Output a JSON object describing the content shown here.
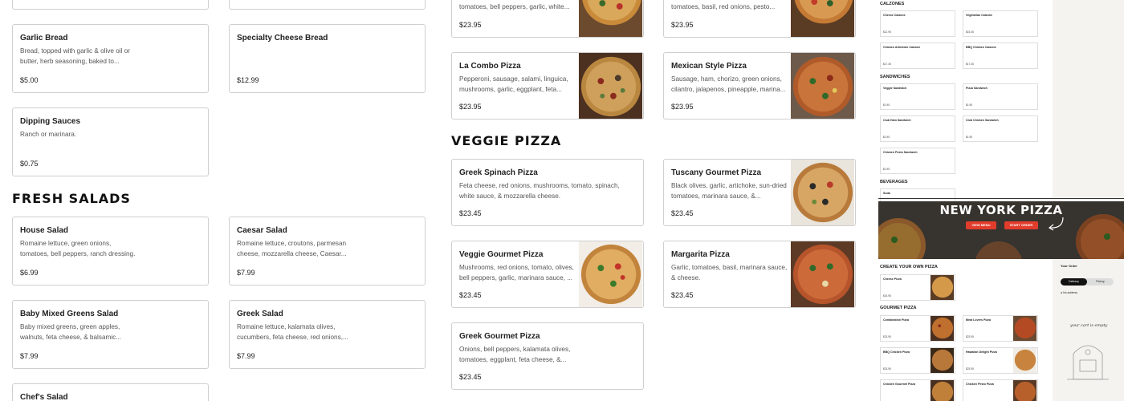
{
  "col1": {
    "sides": [
      {
        "name": "Garlic Bread",
        "desc": "Bread, topped with garlic & olive oil or butter, herb seasoning, baked to...",
        "price": "$5.00"
      },
      {
        "name": "Specialty Cheese Bread",
        "desc": "",
        "price": "$12.99"
      },
      {
        "name": "Dipping Sauces",
        "desc": "Ranch or marinara.",
        "price": "$0.75"
      }
    ],
    "salads_title": "FRESH SALADS",
    "salads": [
      {
        "name": "House Salad",
        "desc": "Romaine lettuce, green onions, tomatoes, bell peppers, ranch dressing.",
        "price": "$6.99"
      },
      {
        "name": "Caesar Salad",
        "desc": "Romaine lettuce, croutons, parmesan cheese, mozzarella cheese, Caesar...",
        "price": "$7.99"
      },
      {
        "name": "Baby Mixed Greens Salad",
        "desc": "Baby mixed greens, green apples, walnuts, feta cheese, & balsamic...",
        "price": "$7.99"
      },
      {
        "name": "Greek Salad",
        "desc": "Romaine lettuce, kalamata olives, cucumbers, feta cheese, red onions,...",
        "price": "$7.99"
      },
      {
        "name": "Chef's Salad",
        "desc": "",
        "price": ""
      }
    ]
  },
  "col2": {
    "top": [
      {
        "name": "",
        "desc": "tomatoes, bell peppers, garlic, white...",
        "price": "$23.95"
      },
      {
        "name": "",
        "desc": "tomatoes, basil, red onions, pesto...",
        "price": "$23.95"
      },
      {
        "name": "La Combo Pizza",
        "desc": "Pepperoni, sausage, salami, linguica, mushrooms, garlic, eggplant, feta...",
        "price": "$23.95"
      },
      {
        "name": "Mexican Style Pizza",
        "desc": "Sausage, ham, chorizo, green onions, cilantro, jalapenos, pineapple, marina...",
        "price": "$23.95"
      }
    ],
    "veggie_title": "VEGGIE PIZZA",
    "veggie": [
      {
        "name": "Greek Spinach Pizza",
        "desc": "Feta cheese, red onions, mushrooms, tomato, spinach, white sauce, & mozzarella cheese.",
        "price": "$23.45"
      },
      {
        "name": "Tuscany Gourmet Pizza",
        "desc": "Black olives, garlic, artichoke, sun-dried tomatoes, marinara sauce, &...",
        "price": "$23.45"
      },
      {
        "name": "Veggie Gourmet Pizza",
        "desc": "Mushrooms, red onions, tomato, olives, bell peppers, garlic, marinara sauce, ...",
        "price": "$23.45"
      },
      {
        "name": "Margarita Pizza",
        "desc": "Garlic, tomatoes, basil, marinara sauce, & cheese.",
        "price": "$23.45"
      },
      {
        "name": "Greek Gourmet Pizza",
        "desc": "Onions, bell peppers, kalamata olives, tomatoes, eggplant, feta cheese, &...",
        "price": "$23.45"
      }
    ]
  },
  "col3": {
    "calzones": "CALZONES",
    "calz": [
      {
        "name": "Cheese Calzone",
        "price": "$12.95"
      },
      {
        "name": "Vegetarian Calzone",
        "price": "$15.45"
      },
      {
        "name": "Chicken Artichoke Calzone",
        "price": "$17.45"
      },
      {
        "name": "BBQ Chicken Calzone",
        "price": "$17.45"
      }
    ],
    "sandwiches": "SANDWICHES",
    "sand": [
      {
        "name": "Veggie Sandwich",
        "price": "$1.95"
      },
      {
        "name": "Pizza Sandwich",
        "price": "$1.95"
      },
      {
        "name": "Club Ham Sandwich",
        "price": "$1.95"
      },
      {
        "name": "Club Chicken Sandwich",
        "price": "$1.95"
      },
      {
        "name": "Chicken Pesto Sandwich",
        "price": "$1.95"
      }
    ],
    "beverages": "BEVERAGES",
    "soda": "Soda",
    "hero_title": "NEW YORK PIZZA",
    "view_menu": "VIEW MENU",
    "start_order": "START ORDER",
    "create": "CREATE YOUR OWN PIZZA",
    "cheese_pizza": "Cheese Pizza",
    "cheese_price": "$15.95",
    "gourmet": "GOURMET PIZZA",
    "gourmet_items": [
      {
        "name": "Combination Pizza",
        "price": "$23.95"
      },
      {
        "name": "Meat Lovers Pizza",
        "price": "$23.95"
      },
      {
        "name": "BBQ Chicken Pizza",
        "price": "$23.95"
      },
      {
        "name": "Hawaiian Delight Pizza",
        "price": "$23.95"
      },
      {
        "name": "Chicken Gourmet Pizza",
        "price": "$23.95"
      },
      {
        "name": "Chicken Pesto Pizza",
        "price": "$23.95"
      }
    ],
    "your_order": "Your Order",
    "delivery": "Delivery",
    "pickup": "Pickup",
    "no_address": "No address",
    "empty": "your cart is empty"
  },
  "colors": {
    "red": "#e23c2c",
    "border": "#cfcfcf"
  }
}
